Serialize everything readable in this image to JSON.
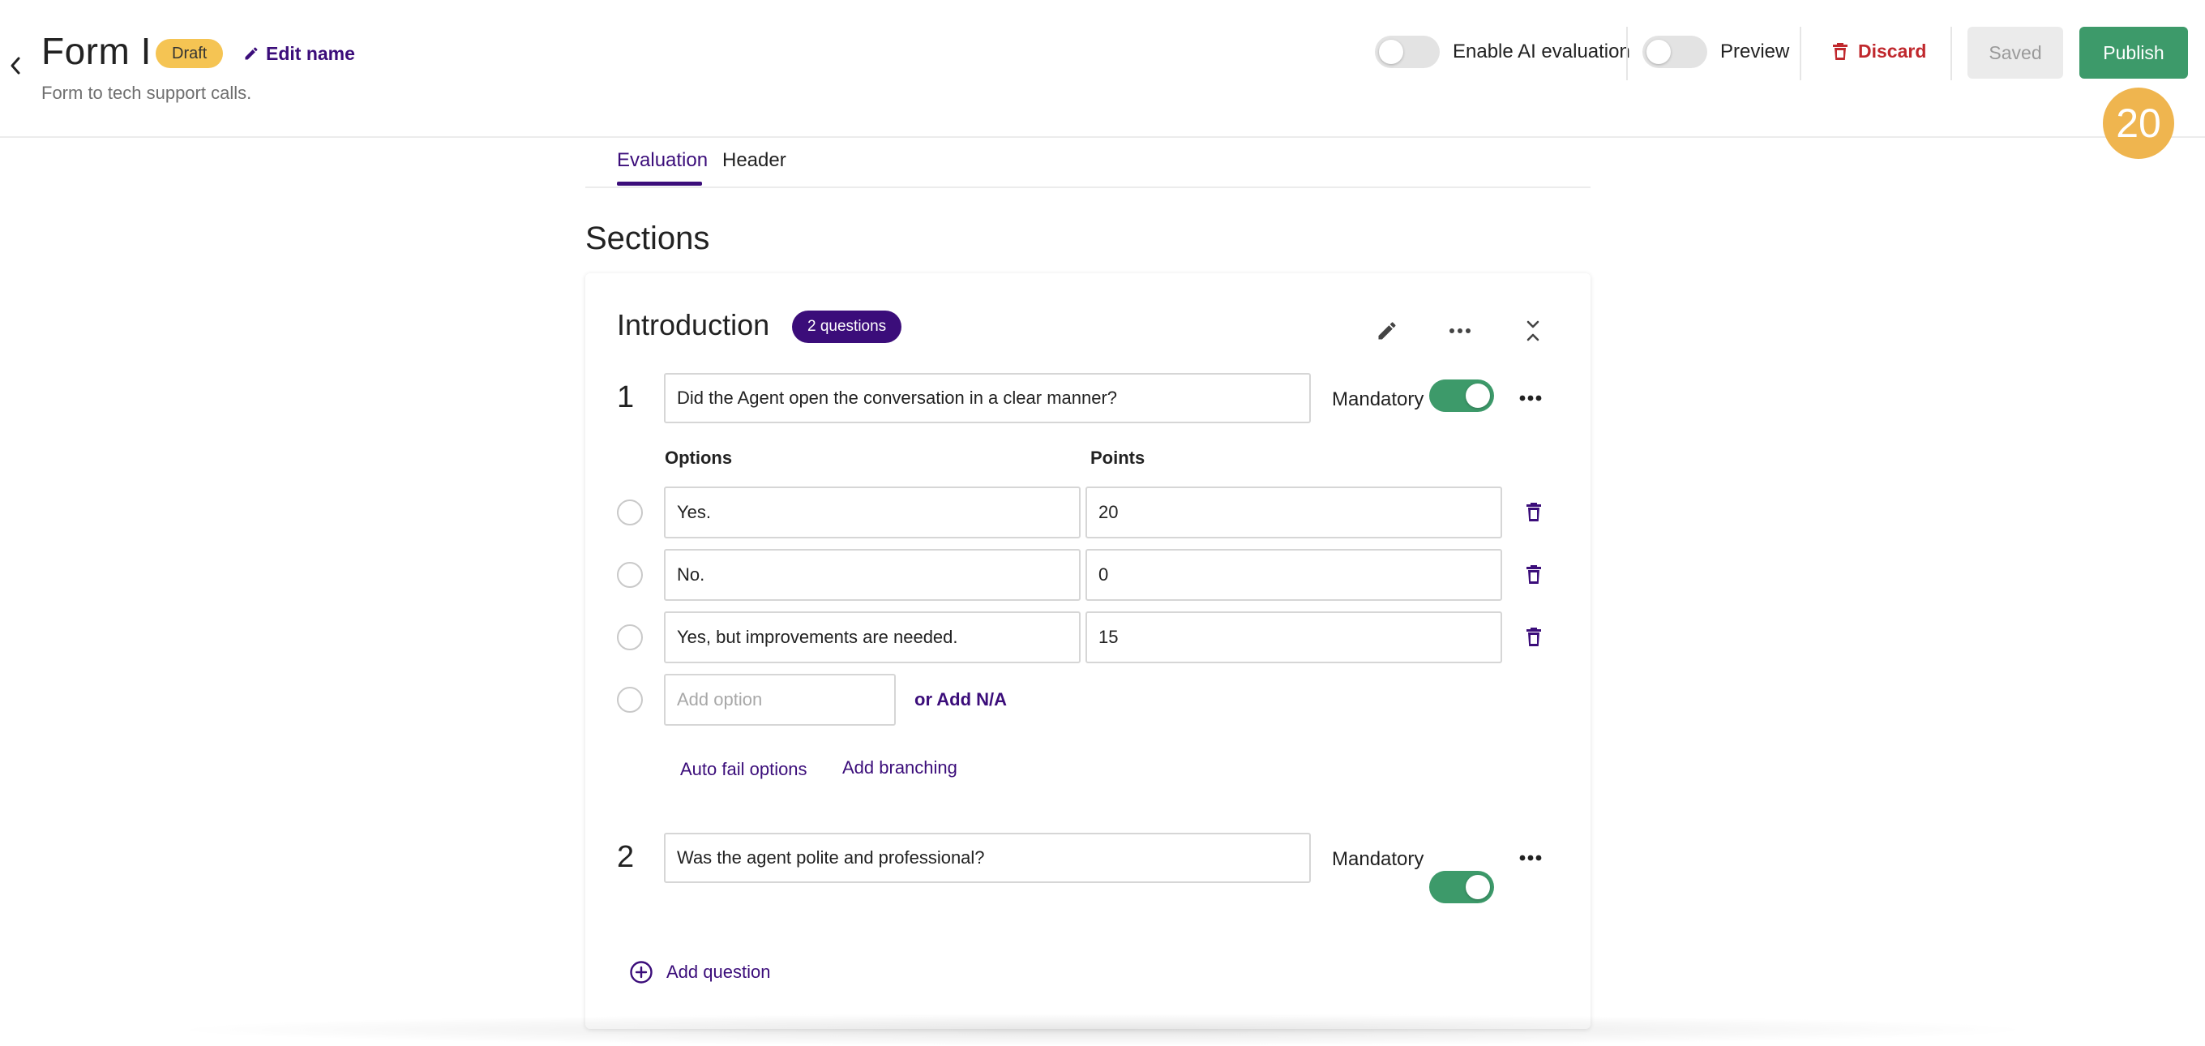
{
  "header": {
    "title": "Form I",
    "status_badge": "Draft",
    "edit_name_label": "Edit name",
    "subtitle": "Form to tech support calls.",
    "ai_toggle_label": "Enable AI evaluation",
    "ai_toggle_on": false,
    "preview_label": "Preview",
    "preview_on": false,
    "discard_label": "Discard",
    "saved_label": "Saved",
    "publish_label": "Publish",
    "score": "20"
  },
  "tabs": [
    {
      "label": "Evaluation",
      "active": true
    },
    {
      "label": "Header",
      "active": false
    }
  ],
  "sections_title": "Sections",
  "section": {
    "title": "Introduction",
    "question_count_badge": "2 questions",
    "questions": [
      {
        "number": "1",
        "text": "Did the Agent open the conversation in a clear manner?",
        "mandatory_label": "Mandatory",
        "mandatory_on": true,
        "options_header": "Options",
        "points_header": "Points",
        "options": [
          {
            "label": "Yes.",
            "points": "20"
          },
          {
            "label": "No.",
            "points": "0"
          },
          {
            "label": "Yes, but improvements are needed.",
            "points": "15"
          }
        ],
        "add_option_placeholder": "Add option",
        "add_na_label": "or Add N/A",
        "auto_fail_label": "Auto fail options",
        "add_branching_label": "Add branching"
      },
      {
        "number": "2",
        "text": "Was the agent polite and professional?",
        "mandatory_label": "Mandatory",
        "mandatory_on": true
      }
    ],
    "add_question_label": "Add question"
  },
  "colors": {
    "accent": "#3b0d7a",
    "success": "#3d9a6a",
    "danger": "#c0282d",
    "badge_draft": "#f5c453",
    "score_circle": "#efb54f"
  },
  "icons": [
    "chevron-left-icon",
    "pencil-icon",
    "trash-icon",
    "edit-section-icon",
    "more-horizontal-icon",
    "collapse-icon",
    "plus-circle-icon"
  ]
}
